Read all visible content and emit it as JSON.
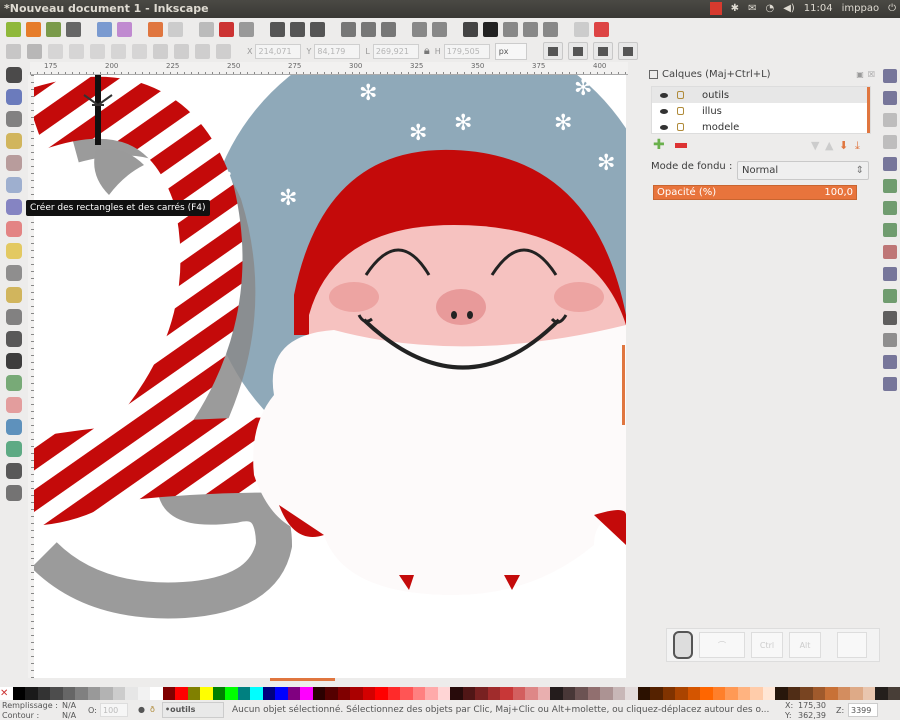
{
  "window": {
    "title": "*Nouveau document 1 - Inkscape"
  },
  "tray": {
    "time": "11:04",
    "user": "imppao"
  },
  "toolbar1": {
    "icons": [
      [
        "new-icon",
        "#8fb83a"
      ],
      [
        "open-icon",
        "#e67c2a"
      ],
      [
        "save-icon",
        "#7a9a4a"
      ],
      [
        "print-icon",
        "#666"
      ],
      [
        "import-icon",
        "#7a9ad0"
      ],
      [
        "export-icon",
        "#c08ad0"
      ],
      [
        "undo-icon",
        "#e0763f"
      ],
      [
        "redo-icon",
        "#ccc"
      ],
      [
        "copy-icon",
        "#bbb"
      ],
      [
        "cut-icon",
        "#c33"
      ],
      [
        "paste-icon",
        "#999"
      ],
      [
        "zoom-selection-icon",
        "#555"
      ],
      [
        "zoom-drawing-icon",
        "#555"
      ],
      [
        "zoom-page-icon",
        "#555"
      ],
      [
        "duplicate-icon",
        "#777"
      ],
      [
        "clone-icon",
        "#777"
      ],
      [
        "unlink-clone-icon",
        "#777"
      ],
      [
        "group-icon",
        "#888"
      ],
      [
        "ungroup-icon",
        "#888"
      ],
      [
        "fill-stroke-icon",
        "#444"
      ],
      [
        "text-font-icon",
        "#222"
      ],
      [
        "layers-icon",
        "#888"
      ],
      [
        "align-icon",
        "#888"
      ],
      [
        "xml-editor-icon",
        "#888"
      ],
      [
        "preferences-icon",
        "#ccc"
      ],
      [
        "document-properties-icon",
        "#d44"
      ]
    ]
  },
  "toolbar2": {
    "icons": [
      [
        "select-all-icon",
        "#999"
      ],
      [
        "select-all-layers-icon",
        "#777"
      ],
      [
        "deselect-icon",
        "#bbb"
      ],
      [
        "rotate-ccw-icon",
        "#bbb"
      ],
      [
        "rotate-cw-icon",
        "#bbb"
      ],
      [
        "flip-h-icon",
        "#bbb"
      ],
      [
        "flip-v-icon",
        "#bbb"
      ],
      [
        "lower-bottom-icon",
        "#aaa"
      ],
      [
        "lower-icon",
        "#aaa"
      ],
      [
        "raise-icon",
        "#aaa"
      ],
      [
        "raise-top-icon",
        "#aaa"
      ]
    ],
    "x_label": "X",
    "x_value": "214,071",
    "y_label": "Y",
    "y_value": "84,179",
    "w_label": "L",
    "w_value": "269,921",
    "h_label": "H",
    "h_value": "179,505",
    "unit": "px"
  },
  "ruler": {
    "ticks": [
      "175",
      "200",
      "225",
      "250",
      "275",
      "300",
      "325",
      "350",
      "375",
      "400"
    ]
  },
  "toolbox": {
    "icons": [
      [
        "selector-tool-icon",
        "#222"
      ],
      [
        "node-tool-icon",
        "#4a5fb0"
      ],
      [
        "tweak-tool-icon",
        "#666"
      ],
      [
        "zoom-tool-icon",
        "#c9a73a"
      ],
      [
        "measure-tool-icon",
        "#a88"
      ],
      [
        "rectangle-tool-icon",
        "#8aa0c8"
      ],
      [
        "3d-box-tool-icon",
        "#6a6ab8"
      ],
      [
        "ellipse-tool-icon",
        "#e06a6a"
      ],
      [
        "star-tool-icon",
        "#e0c040"
      ],
      [
        "spiral-tool-icon",
        "#777"
      ],
      [
        "pencil-tool-icon",
        "#c9a73a"
      ],
      [
        "pen-tool-icon",
        "#666"
      ],
      [
        "calligraphy-tool-icon",
        "#333"
      ],
      [
        "text-tool-icon",
        "#111"
      ],
      [
        "spray-tool-icon",
        "#5a9a5a"
      ],
      [
        "eraser-tool-icon",
        "#e08a8a"
      ],
      [
        "paint-bucket-tool-icon",
        "#3a7ab0"
      ],
      [
        "gradient-tool-icon",
        "#3a9a6a"
      ],
      [
        "dropper-tool-icon",
        "#333"
      ],
      [
        "connector-tool-icon",
        "#555"
      ]
    ]
  },
  "tooltip": "Créer des rectangles et des carrés (F4)",
  "layers_panel": {
    "title": "Calques (Maj+Ctrl+L)",
    "layers": [
      {
        "name": "outils",
        "selected": true
      },
      {
        "name": "illus",
        "selected": false
      },
      {
        "name": "modele",
        "selected": false
      }
    ],
    "blend_label": "Mode de fondu :",
    "blend_value": "Normal",
    "opacity_label": "Opacité (%)",
    "opacity_value": "100,0"
  },
  "rbar": {
    "icons": [
      [
        "snap-toggle-icon",
        "#447"
      ],
      [
        "snap-bbox-icon",
        "#447"
      ],
      [
        "snap-edge-icon",
        "#aaa"
      ],
      [
        "snap-corner-icon",
        "#aaa"
      ],
      [
        "snap-nodes-icon",
        "#447"
      ],
      [
        "snap-path-icon",
        "#3a7a3a"
      ],
      [
        "snap-intersection-icon",
        "#3a7a3a"
      ],
      [
        "snap-smooth-icon",
        "#3a7a3a"
      ],
      [
        "snap-midpoint-icon",
        "#a44"
      ],
      [
        "snap-center-icon",
        "#447"
      ],
      [
        "snap-rotation-icon",
        "#3a7a3a"
      ],
      [
        "snap-text-icon",
        "#222"
      ],
      [
        "snap-page-icon",
        "#666"
      ],
      [
        "snap-grid-icon",
        "#447"
      ],
      [
        "snap-guide-icon",
        "#447"
      ]
    ]
  },
  "keys": {
    "ctrl": "Ctrl",
    "alt": "Alt"
  },
  "palette": {
    "colors": [
      "#000",
      "#1a1a1a",
      "#333",
      "#4d4d4d",
      "#666",
      "#808080",
      "#999",
      "#b3b3b3",
      "#ccc",
      "#e6e6e6",
      "#f2f2f2",
      "#fff",
      "#800000",
      "#ff0000",
      "#808000",
      "#ffff00",
      "#008000",
      "#00ff00",
      "#008080",
      "#00ffff",
      "#000080",
      "#0000ff",
      "#800080",
      "#ff00ff",
      "#2b0000",
      "#550000",
      "#800000",
      "#aa0000",
      "#d40000",
      "#ff0000",
      "#ff2a2a",
      "#ff5555",
      "#ff8080",
      "#ffaaaa",
      "#ffd5d5",
      "#280b0b",
      "#501616",
      "#782121",
      "#a02c2c",
      "#c83737",
      "#d35f5f",
      "#de8787",
      "#e9afaf",
      "#241c1c",
      "#483737",
      "#6c5353",
      "#916f6f",
      "#ac9393",
      "#c8b7b7",
      "#e3dbdb",
      "#2b1100",
      "#552200",
      "#803300",
      "#aa4400",
      "#d45500",
      "#ff6600",
      "#ff7f2a",
      "#ff9955",
      "#ffb380",
      "#ffccaa",
      "#ffe6d5",
      "#28170b",
      "#502d16",
      "#784421",
      "#a05a2c",
      "#c87137",
      "#d38d5f",
      "#deaa87",
      "#e9c6af",
      "#241f1c",
      "#483e37"
    ]
  },
  "status": {
    "fill_label": "Remplissage :",
    "fill_value": "N/A",
    "stroke_label": "Contour :",
    "stroke_value": "N/A",
    "opacity_label": "O:",
    "opacity_value": "100",
    "layer": "•outils",
    "message": "Aucun objet sélectionné. Sélectionnez des objets par Clic, Maj+Clic ou Alt+molette, ou cliquez-déplacez autour des o...",
    "x_label": "X:",
    "x": "175,30",
    "y_label": "Y:",
    "y": "362,39",
    "zoom_label": "Z:",
    "zoom": "3399"
  }
}
